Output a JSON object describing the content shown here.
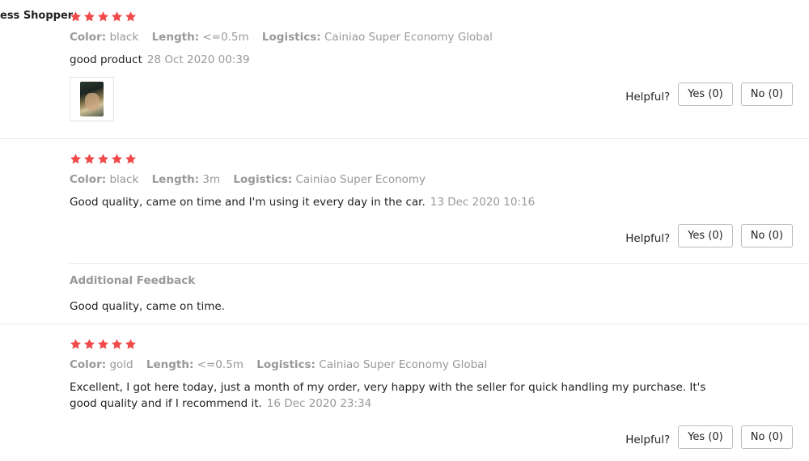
{
  "reviews": [
    {
      "shopper": "ess Shopper",
      "rating": 5,
      "color_label": "Color:",
      "color_value": "black",
      "length_label": "Length:",
      "length_value": "<=0.5m",
      "logistics_label": "Logistics:",
      "logistics_value": "Cainiao Super Economy Global",
      "text": "good product",
      "date": "28 Oct 2020 00:39",
      "helpful_label": "Helpful?",
      "yes_label": "Yes (0)",
      "no_label": "No (0)"
    },
    {
      "rating": 5,
      "color_label": "Color:",
      "color_value": "black",
      "length_label": "Length:",
      "length_value": "3m",
      "logistics_label": "Logistics:",
      "logistics_value": "Cainiao Super Economy",
      "text": "Good quality, came on time and I'm using it every day in the car.",
      "date": "13 Dec 2020 10:16",
      "helpful_label": "Helpful?",
      "yes_label": "Yes (0)",
      "no_label": "No (0)",
      "additional_feedback_title": "Additional Feedback",
      "additional_feedback_text": "Good quality, came on time."
    },
    {
      "rating": 5,
      "color_label": "Color:",
      "color_value": "gold",
      "length_label": "Length:",
      "length_value": "<=0.5m",
      "logistics_label": "Logistics:",
      "logistics_value": "Cainiao Super Economy Global",
      "text_line1": "Excellent, I got here today, just a month of my order, very happy with the seller for quick handling my purchase. It's",
      "text_line2": "good quality and if I recommend it.",
      "date": "16 Dec 2020 23:34",
      "helpful_label": "Helpful?",
      "yes_label": "Yes (0)",
      "no_label": "No (0)"
    }
  ],
  "colors": {
    "star": "#f04a4a",
    "muted_text": "#999999",
    "divider": "#e8e8e8"
  }
}
